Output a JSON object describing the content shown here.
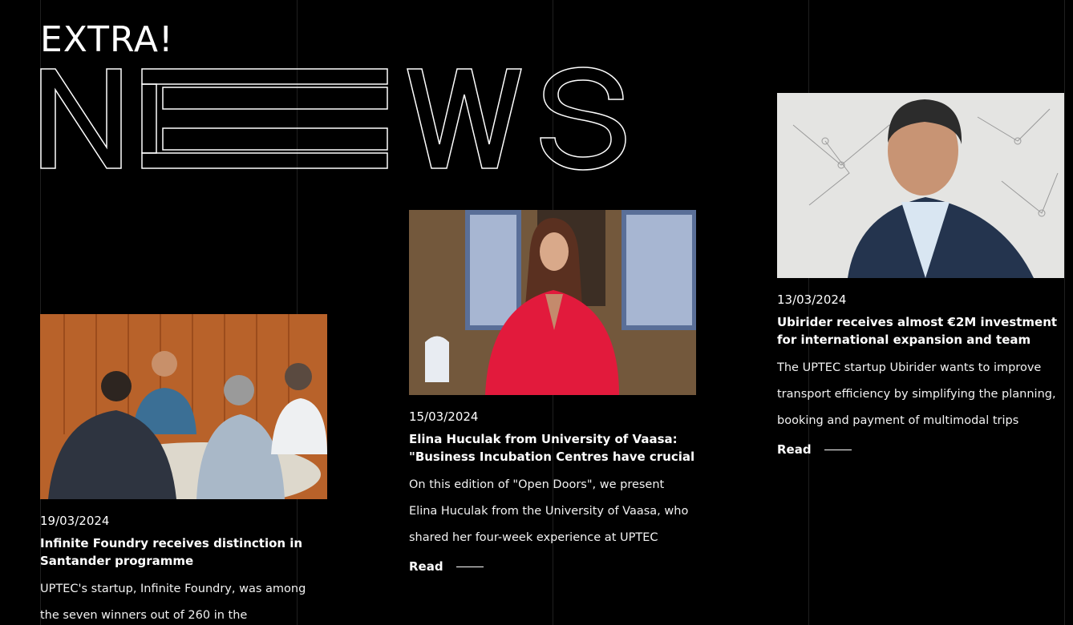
{
  "header": {
    "kicker": "EXTRA!",
    "headline_letters": [
      "N",
      "E",
      "W",
      "S"
    ]
  },
  "articles": [
    {
      "date": "19/03/2024",
      "title": "Infinite Foundry receives distinction in Santander programme",
      "excerpt": "UPTEC's startup, Infinite Foundry, was among the seven winners out of 260 in the",
      "read_label": ""
    },
    {
      "date": "15/03/2024",
      "title": "Elina Huculak from University of Vaasa: \"Business Incubation Centres have crucial",
      "excerpt": "On this edition of \"Open Doors\", we present Elina Huculak from the University of Vaasa, who shared her four-week experience at UPTEC",
      "read_label": "Read"
    },
    {
      "date": "13/03/2024",
      "title": "Ubirider receives almost €2M investment for international expansion and team",
      "excerpt": "The UPTEC startup Ubirider wants to improve transport efficiency by simplifying the planning, booking and payment of multimodal trips",
      "read_label": "Read"
    }
  ],
  "colors": {
    "background": "#000000",
    "text": "#ffffff",
    "gridline": "rgba(255,255,255,0.12)"
  }
}
